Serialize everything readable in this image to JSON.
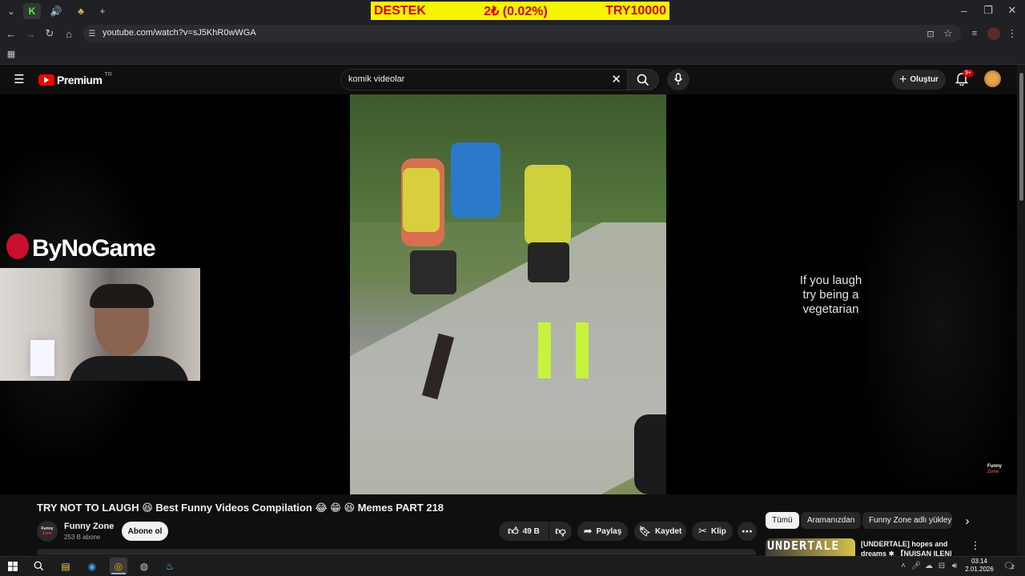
{
  "browser": {
    "url": "youtube.com/watch?v=sJ5KhR0wWGA",
    "tabs": [
      {
        "icon": "kick-icon"
      },
      {
        "icon": "audio-icon"
      },
      {
        "icon": "game-icon"
      }
    ],
    "new_tab_label": "+"
  },
  "donation_banner": {
    "left": "DESTEK",
    "center": "2₺ (0.02%)",
    "right": "TRY10000",
    "bg": "#f5f500",
    "fg": "#d40000"
  },
  "youtube": {
    "logo_text": "Premium",
    "logo_sup": "TR",
    "search_value": "komik videolar",
    "create_label": "Oluştur",
    "notification_badge": "9+"
  },
  "video": {
    "overlay_brand": "ByNoGame",
    "side_text": "If you laugh try being a vegetarian",
    "watermark_line1": "Funny",
    "watermark_line2": "Zone",
    "title": "TRY NOT TO LAUGH 😆 Best Funny Videos Compilation 😂 😁 😆 Memes PART 218",
    "channel_avatar_line1": "Funny",
    "channel_avatar_line2": "Zone",
    "channel_name": "Funny Zone",
    "subscribers": "253 B abone",
    "subscribe_label": "Abone ol",
    "like_count": "49 B",
    "share_label": "Paylaş",
    "save_label": "Kaydet",
    "clip_label": "Klip"
  },
  "chips": [
    "Tümü",
    "Aramanızdan",
    "Funny Zone adlı yükleyic"
  ],
  "recommendation": {
    "thumb_text": "UNDERTALE",
    "title_line1": "[UNDERTALE] hopes and",
    "title_line2": "dreams ✱ 【NUISAN ILEN|"
  },
  "taskbar": {
    "time": "03:14",
    "date": "2.01.2026",
    "notif_count": "2"
  }
}
